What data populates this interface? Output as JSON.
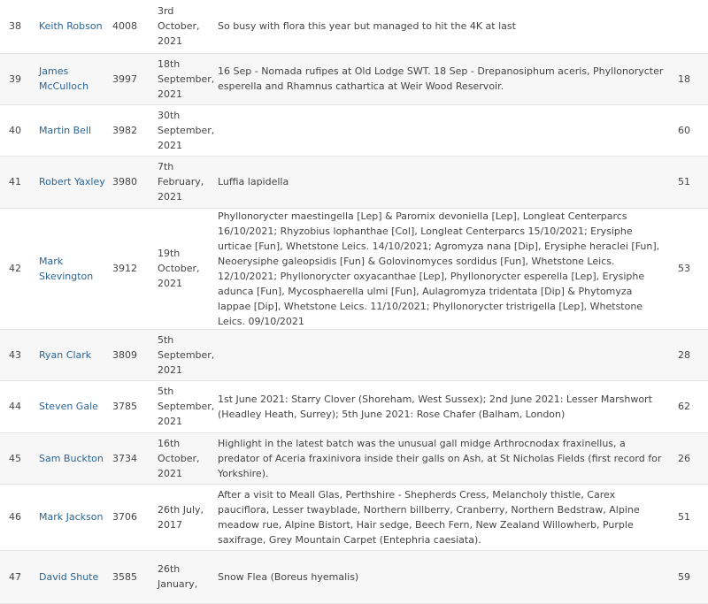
{
  "rows": [
    {
      "rank": "38",
      "name": "Keith Robson",
      "total": "4008",
      "date": "3rd October, 2021",
      "note": "So busy with flora this year but managed to hit the 4K at last",
      "count": ""
    },
    {
      "rank": "39",
      "name": "James McCulloch",
      "total": "3997",
      "date": "18th September, 2021",
      "note": "16 Sep - Nomada rufipes at Old Lodge SWT. 18 Sep - Drepanosiphum aceris, Phyllonorycter esperella and Rhamnus cathartica at Weir Wood Reservoir.",
      "count": "18"
    },
    {
      "rank": "40",
      "name": "Martin Bell",
      "total": "3982",
      "date": "30th September, 2021",
      "note": "",
      "count": "60"
    },
    {
      "rank": "41",
      "name": "Robert Yaxley",
      "total": "3980",
      "date": "7th February, 2021",
      "note": "Luffia lapidella",
      "count": "51"
    },
    {
      "rank": "42",
      "name": "Mark Skevington",
      "total": "3912",
      "date": "19th October, 2021",
      "note": "Phyllonorycter maestingella [Lep] & Parornix devoniella [Lep], Longleat Centerparcs 16/10/2021; Rhyzobius lophanthae [Col], Longleat Centerparcs 15/10/2021; Erysiphe urticae [Fun], Whetstone Leics. 14/10/2021; Agromyza nana [Dip], Erysiphe heraclei [Fun], Neoerysiphe galeopsidis [Fun] & Golovinomyces sordidus [Fun], Whetstone Leics. 12/10/2021; Phyllonorycter oxyacanthae [Lep], Phyllonorycter esperella [Lep], Erysiphe adunca [Fun], Mycosphaerella ulmi [Fun], Aulagromyza tridentata [Dip] & Phytomyza lappae [Dip], Whetstone Leics. 11/10/2021; Phyllonorycter tristrigella [Lep], Whetstone Leics. 09/10/2021",
      "count": "53"
    },
    {
      "rank": "43",
      "name": "Ryan Clark",
      "total": "3809",
      "date": "5th September, 2021",
      "note": "",
      "count": "28"
    },
    {
      "rank": "44",
      "name": "Steven Gale",
      "total": "3785",
      "date": "5th September, 2021",
      "note": "1st June 2021: Starry Clover (Shoreham, West Sussex); 2nd June 2021: Lesser Marshwort (Headley Heath, Surrey); 5th June 2021: Rose Chafer (Balham, London)",
      "count": "62"
    },
    {
      "rank": "45",
      "name": "Sam Buckton",
      "total": "3734",
      "date": "16th October, 2021",
      "note": "Highlight in the latest batch was the unusual gall midge Arthrocnodax fraxinellus, a predator of Aceria fraxinivora inside their galls on Ash, at St Nicholas Fields (first record for Yorkshire).",
      "count": "26"
    },
    {
      "rank": "46",
      "name": "Mark Jackson",
      "total": "3706",
      "date": "26th July, 2017",
      "note": "After a visit to Meall Glas, Perthshire - Shepherds Cress, Melancholy thistle, Carex pauciflora, Lesser twayblade, Northern billberry, Cranberry, Northern Bedstraw, Alpine meadow rue, Alpine Bistort, Hair sedge, Beech Fern, New Zealand Willowherb, Purple saxifrage, Grey Mountain Carpet (Entephria caesiata).",
      "count": "51"
    },
    {
      "rank": "47",
      "name": "David Shute",
      "total": "3585",
      "date": "26th January,",
      "note": "Snow Flea (Boreus hyemalis)",
      "count": "59"
    }
  ]
}
